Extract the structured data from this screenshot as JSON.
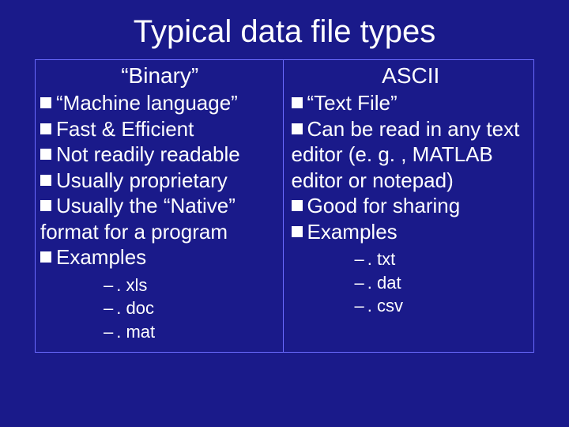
{
  "title": "Typical data file types",
  "left": {
    "heading": "“Binary”",
    "items": [
      "“Machine language”",
      "Fast & Efficient",
      "Not readily readable",
      "Usually proprietary",
      "Usually the “Native” format for a program",
      "Examples"
    ],
    "subitems": [
      ". xls",
      ". doc",
      ". mat"
    ]
  },
  "right": {
    "heading": "ASCII",
    "items": [
      "“Text File”",
      "Can be read in any text editor (e. g. , MATLAB editor or notepad)",
      "Good for sharing",
      "Examples"
    ],
    "subitems": [
      ". txt",
      ". dat",
      ". csv"
    ]
  }
}
